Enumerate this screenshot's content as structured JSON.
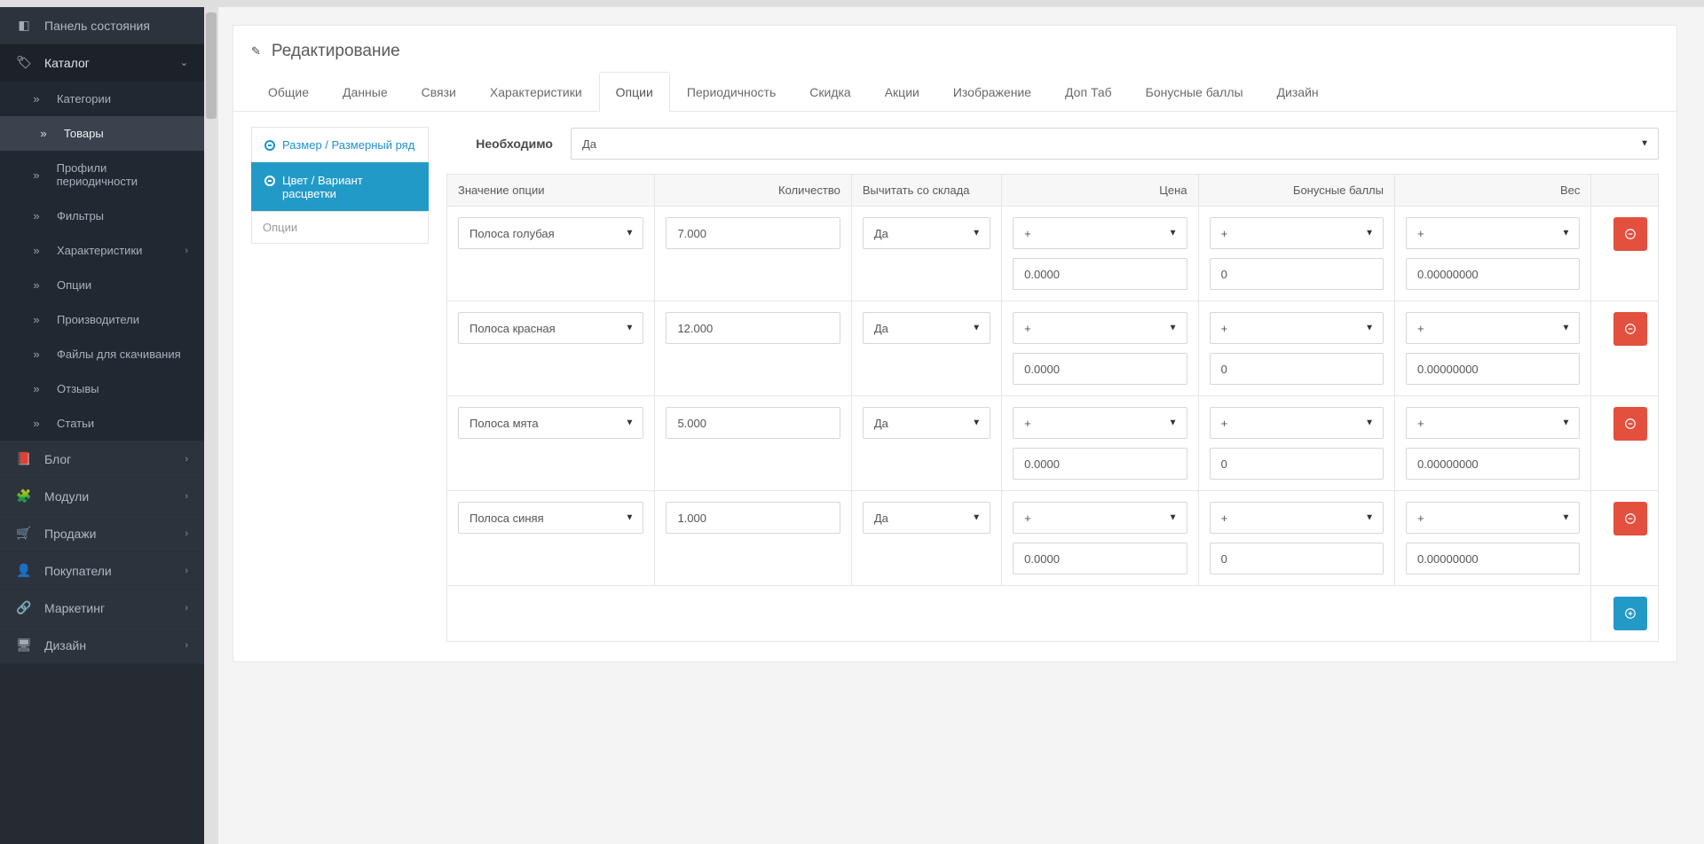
{
  "sidebar": {
    "dashboard": "Панель состояния",
    "catalog": "Каталог",
    "sub": {
      "categories": "Категории",
      "products": "Товары",
      "profiles": "Профили периодичности",
      "filters": "Фильтры",
      "attributes": "Характеристики",
      "options": "Опции",
      "manufacturers": "Производители",
      "downloads": "Файлы для скачивания",
      "reviews": "Отзывы",
      "articles": "Статьи"
    },
    "blog": "Блог",
    "modules": "Модули",
    "sales": "Продажи",
    "customers": "Покупатели",
    "marketing": "Маркетинг",
    "design": "Дизайн"
  },
  "page": {
    "title": "Редактирование",
    "tabs": {
      "general": "Общие",
      "data": "Данные",
      "links": "Связи",
      "attribute": "Характеристики",
      "option": "Опции",
      "recurring": "Периодичность",
      "discount": "Скидка",
      "special": "Акции",
      "image": "Изображение",
      "extratab": "Доп Таб",
      "reward": "Бонусные баллы",
      "design": "Дизайн"
    },
    "optionTabs": {
      "size": "Размер / Размерный ряд",
      "color": "Цвет / Вариант расцветки",
      "placeholder": "Опции"
    },
    "need": {
      "label": "Необходимо",
      "value": "Да"
    },
    "table": {
      "headers": {
        "value": "Значение опции",
        "qty": "Количество",
        "subtract": "Вычитать со склада",
        "price": "Цена",
        "points": "Бонусные баллы",
        "weight": "Вес"
      },
      "plus": "+",
      "rows": [
        {
          "value": "Полоса голубая",
          "qty": "7.000",
          "subtract": "Да",
          "price": "0.0000",
          "points": "0",
          "weight": "0.00000000"
        },
        {
          "value": "Полоса красная",
          "qty": "12.000",
          "subtract": "Да",
          "price": "0.0000",
          "points": "0",
          "weight": "0.00000000"
        },
        {
          "value": "Полоса мята",
          "qty": "5.000",
          "subtract": "Да",
          "price": "0.0000",
          "points": "0",
          "weight": "0.00000000"
        },
        {
          "value": "Полоса синяя",
          "qty": "1.000",
          "subtract": "Да",
          "price": "0.0000",
          "points": "0",
          "weight": "0.00000000"
        }
      ]
    }
  }
}
